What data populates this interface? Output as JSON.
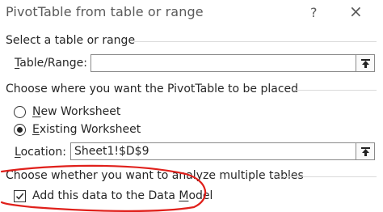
{
  "window": {
    "title": "PivotTable from table or range",
    "help_glyph": "?",
    "close_glyph": "×"
  },
  "select_section": {
    "heading": "Select a table or range",
    "table_range": {
      "label_mnemonic": "T",
      "label_rest": "able/Range:",
      "value": "",
      "button_icon": "collapse-dialog-icon"
    }
  },
  "placement_section": {
    "heading": "Choose where you want the PivotTable to be placed",
    "new_worksheet": {
      "mnemonic": "N",
      "rest": "ew Worksheet",
      "selected": false
    },
    "existing_worksheet": {
      "mnemonic": "E",
      "rest": "xisting Worksheet",
      "selected": true
    },
    "location": {
      "label_mnemonic": "L",
      "label_rest": "ocation:",
      "value": "Sheet1!$D$9",
      "button_icon": "collapse-dialog-icon"
    }
  },
  "multi_table_section": {
    "heading": "Choose whether you want to analyze multiple tables",
    "data_model_checkbox": {
      "checked": true,
      "label_before": "Add this data to the Data ",
      "label_mnemonic": "M",
      "label_after": "odel"
    }
  },
  "annotation": {
    "color": "#e0201b"
  }
}
